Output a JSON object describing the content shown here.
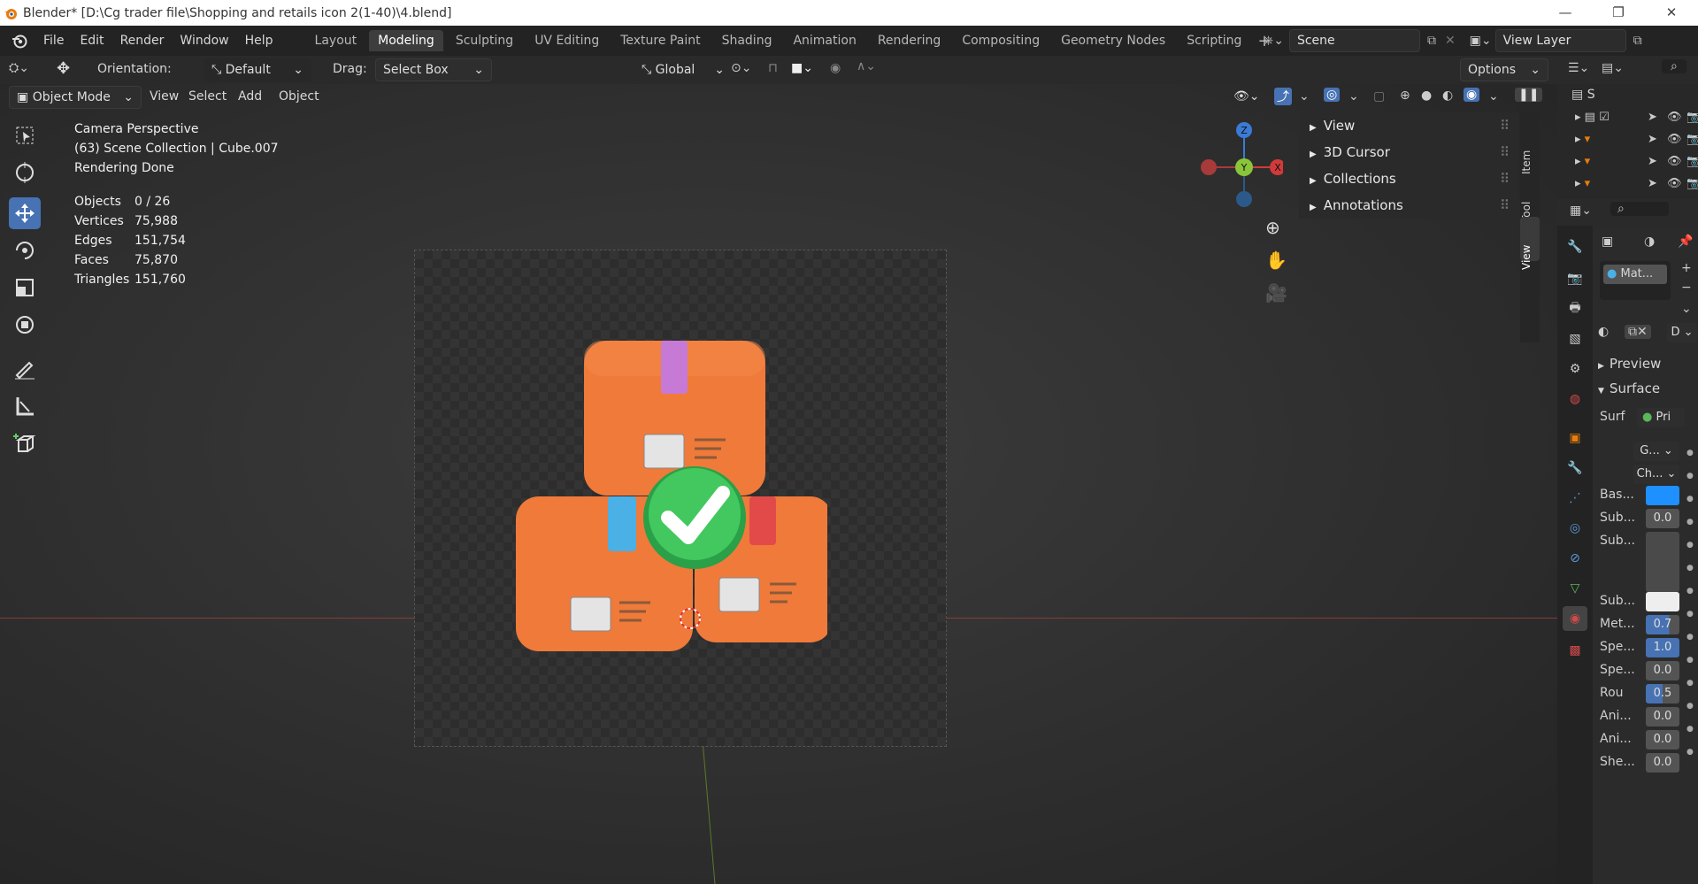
{
  "window": {
    "title": "Blender* [D:\\Cg trader file\\Shopping and retails icon 2(1-40)\\4.blend]",
    "minimize": "—",
    "maximize": "❐",
    "close": "✕"
  },
  "menu": [
    "File",
    "Edit",
    "Render",
    "Window",
    "Help"
  ],
  "workspaces": [
    "Layout",
    "Modeling",
    "Sculpting",
    "UV Editing",
    "Texture Paint",
    "Shading",
    "Animation",
    "Rendering",
    "Compositing",
    "Geometry Nodes",
    "Scripting"
  ],
  "active_workspace": "Modeling",
  "scene": {
    "name": "Scene",
    "view_layer": "View Layer"
  },
  "tool_header": {
    "orientation_label": "Orientation:",
    "orientation_value": "Default",
    "drag_label": "Drag:",
    "drag_value": "Select Box",
    "transform_orientation": "Global",
    "options": "Options"
  },
  "viewport_header": {
    "mode": "Object Mode",
    "menus": [
      "View",
      "Select",
      "Add",
      "Object"
    ]
  },
  "viewport_info": {
    "line1": "Camera Perspective",
    "line2": "(63) Scene Collection | Cube.007",
    "line3": "Rendering Done",
    "stats": [
      {
        "label": "Objects",
        "value": "0 / 26"
      },
      {
        "label": "Vertices",
        "value": "75,988"
      },
      {
        "label": "Edges",
        "value": "151,754"
      },
      {
        "label": "Faces",
        "value": "75,870"
      },
      {
        "label": "Triangles",
        "value": "151,760"
      }
    ]
  },
  "gizmo": {
    "z": "Z",
    "y": "Y",
    "x": "X"
  },
  "sidebar_panels": [
    "View",
    "3D Cursor",
    "Collections",
    "Annotations"
  ],
  "sidebar_tabs": [
    "Item",
    "Tool",
    "View"
  ],
  "outliner": {
    "root": "S"
  },
  "properties": {
    "material_slot": "Mat...",
    "preview": "Preview",
    "surface": "Surface",
    "surf_label": "Surf",
    "surf_value": "Pri",
    "rows": [
      {
        "label": "",
        "value": "G..."
      },
      {
        "label": "",
        "value": "Ch..."
      },
      {
        "label": "Bas...",
        "value": ""
      },
      {
        "label": "Sub...",
        "value": "0.0"
      },
      {
        "label": "Sub...",
        "value": ""
      },
      {
        "label": "Sub...",
        "value": ""
      },
      {
        "label": "Met...",
        "value": "0.7"
      },
      {
        "label": "Spe...",
        "value": "1.0"
      },
      {
        "label": "Spe...",
        "value": "0.0"
      },
      {
        "label": "Rou",
        "value": "0.5"
      },
      {
        "label": "Ani...",
        "value": "0.0"
      },
      {
        "label": "Ani...",
        "value": "0.0"
      },
      {
        "label": "She...",
        "value": "0.0"
      }
    ],
    "dropdown_d": "D"
  },
  "colors": {
    "accent": "#4772b3",
    "base_color_swatch": "#1e90ff",
    "box_orange": "#f07a3a",
    "check_green": "#3cc45a"
  }
}
